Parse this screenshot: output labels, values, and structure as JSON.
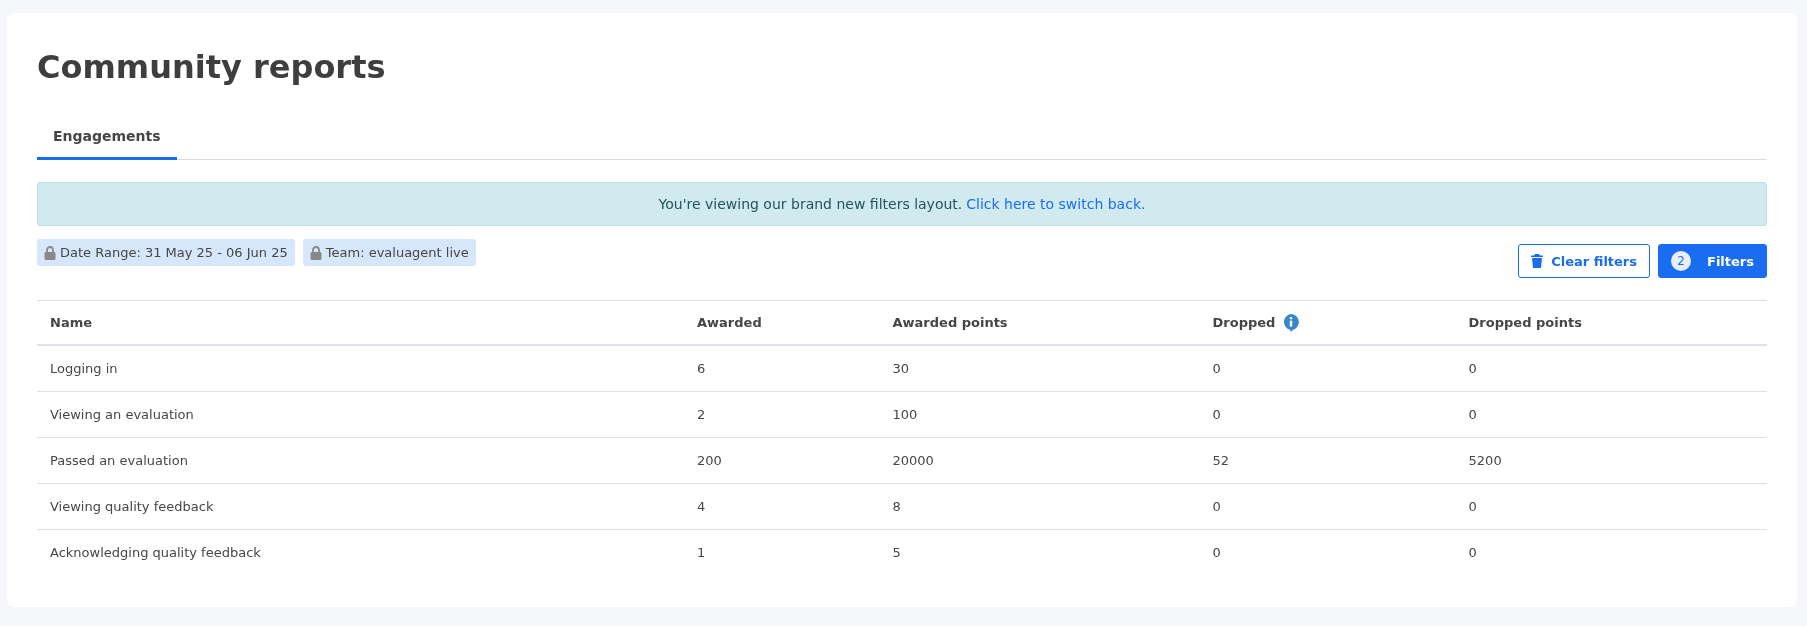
{
  "page": {
    "title": "Community reports"
  },
  "tabs": [
    {
      "label": "Engagements",
      "selected": true
    }
  ],
  "banner": {
    "text": "You're viewing our brand new filters layout.",
    "link": "Click here to switch back."
  },
  "filter_chips": [
    {
      "label": "Date Range: 31 May 25 - 06 Jun 25",
      "locked": true
    },
    {
      "label": "Team: evaluagent live",
      "locked": true
    }
  ],
  "actions": {
    "clear": "Clear filters",
    "filters": "Filters",
    "filter_count": "2"
  },
  "table": {
    "columns": [
      {
        "label": "Name",
        "info": false
      },
      {
        "label": "Awarded",
        "info": false
      },
      {
        "label": "Awarded points",
        "info": false
      },
      {
        "label": "Dropped",
        "info": true
      },
      {
        "label": "Dropped points",
        "info": false
      }
    ],
    "rows": [
      [
        "Logging in",
        "6",
        "30",
        "0",
        "0"
      ],
      [
        "Viewing an evaluation",
        "2",
        "100",
        "0",
        "0"
      ],
      [
        "Passed an evaluation",
        "200",
        "20000",
        "52",
        "5200"
      ],
      [
        "Viewing quality feedback",
        "4",
        "8",
        "0",
        "0"
      ],
      [
        "Acknowledging quality feedback",
        "1",
        "5",
        "0",
        "0"
      ]
    ]
  }
}
